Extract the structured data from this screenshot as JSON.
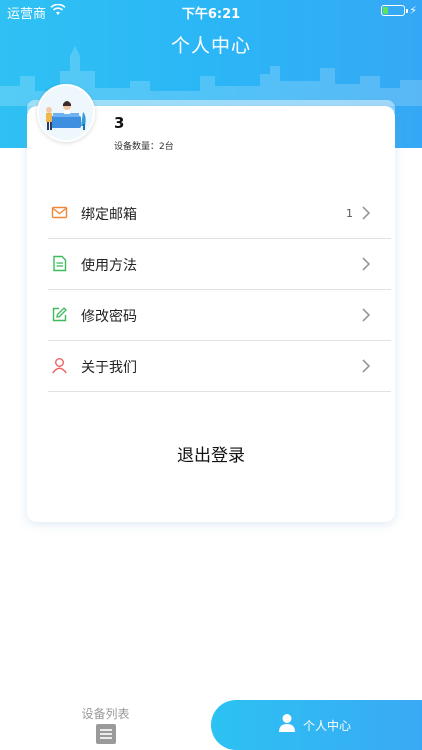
{
  "status_bar": {
    "carrier": "运营商",
    "time": "下午6:21",
    "battery_level": 0.25
  },
  "header": {
    "title": "个人中心"
  },
  "profile": {
    "username": "3",
    "device_count_text": "设备数量：2台"
  },
  "menu": {
    "items": [
      {
        "label": "绑定邮箱",
        "badge": "1",
        "icon": "mail-icon"
      },
      {
        "label": "使用方法",
        "badge": "",
        "icon": "document-icon"
      },
      {
        "label": "修改密码",
        "badge": "",
        "icon": "edit-icon"
      },
      {
        "label": "关于我们",
        "badge": "",
        "icon": "person-icon"
      }
    ]
  },
  "logout_label": "退出登录",
  "tabbar": {
    "tabs": [
      {
        "label": "设备列表",
        "icon": "list-icon",
        "active": false
      },
      {
        "label": "个人中心",
        "icon": "user-icon",
        "active": true
      }
    ]
  },
  "colors": {
    "header_gradient_start": "#2fc1f3",
    "header_gradient_end": "#35a8f5",
    "mail_icon": "#f0883a",
    "document_icon": "#3dbb5c",
    "edit_icon": "#3dbb5c",
    "person_icon": "#f06060"
  }
}
